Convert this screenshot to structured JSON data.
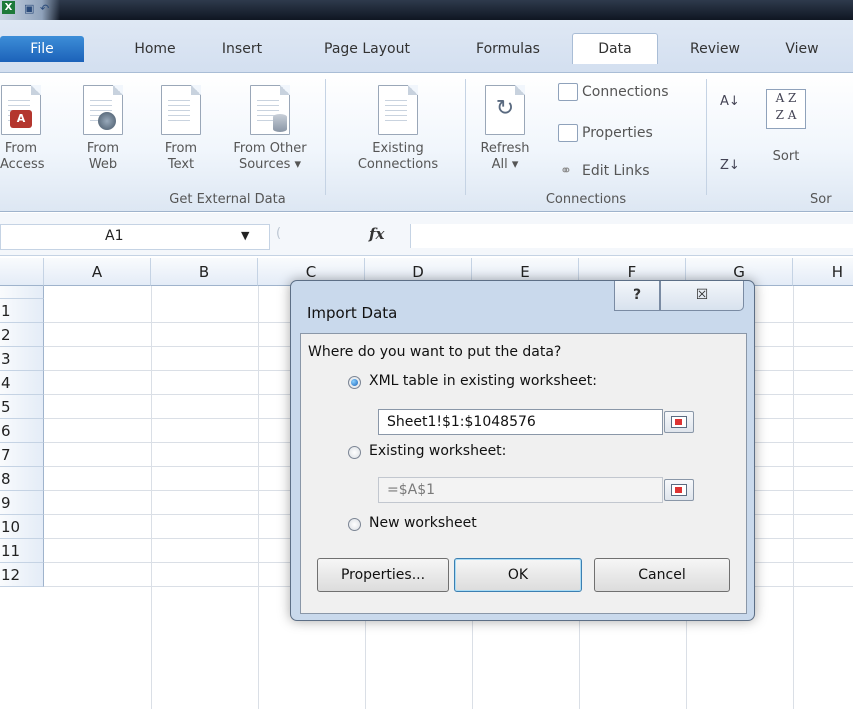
{
  "ribbon_tabs": {
    "file": "File",
    "home": "Home",
    "insert": "Insert",
    "page_layout": "Page Layout",
    "formulas": "Formulas",
    "data": "Data",
    "review": "Review",
    "view": "View",
    "active": "Data"
  },
  "get_external_data": {
    "group_label": "Get External Data",
    "from_access": [
      "From",
      "Access"
    ],
    "from_web": [
      "From",
      "Web"
    ],
    "from_text": [
      "From",
      "Text"
    ],
    "from_other": [
      "From Other",
      "Sources ▾"
    ],
    "existing": [
      "Existing",
      "Connections"
    ]
  },
  "connections": {
    "group_label": "Connections",
    "refresh": [
      "Refresh",
      "All ▾"
    ],
    "connections": "Connections",
    "properties": "Properties",
    "edit_links": "Edit Links"
  },
  "sort_filter": {
    "group_label_partial": "Sor",
    "sort": "Sort"
  },
  "formula_bar": {
    "name_box": "A1",
    "fx": "fx",
    "formula": ""
  },
  "grid": {
    "columns": [
      "A",
      "B",
      "C",
      "D",
      "E",
      "F",
      "G",
      "H"
    ],
    "rows": [
      "1",
      "2",
      "3",
      "4",
      "5",
      "6",
      "7",
      "8",
      "9",
      "10",
      "11",
      "12"
    ]
  },
  "dialog": {
    "title": "Import Data",
    "help": "?",
    "close": "☒",
    "question": "Where do you want to put the data?",
    "options": [
      {
        "label": "XML table in existing worksheet:",
        "selected": true,
        "value": "Sheet1!$1:$1048576"
      },
      {
        "label": "Existing worksheet:",
        "selected": false,
        "value": "=$A$1"
      },
      {
        "label": "New worksheet",
        "selected": false
      }
    ],
    "buttons": {
      "properties": "Properties...",
      "ok": "OK",
      "cancel": "Cancel"
    }
  },
  "colors": {
    "file_tab": "#1c62b9",
    "ribbon_bg": "#f1f6fc",
    "dialog_frame": "#c9d9ec"
  }
}
